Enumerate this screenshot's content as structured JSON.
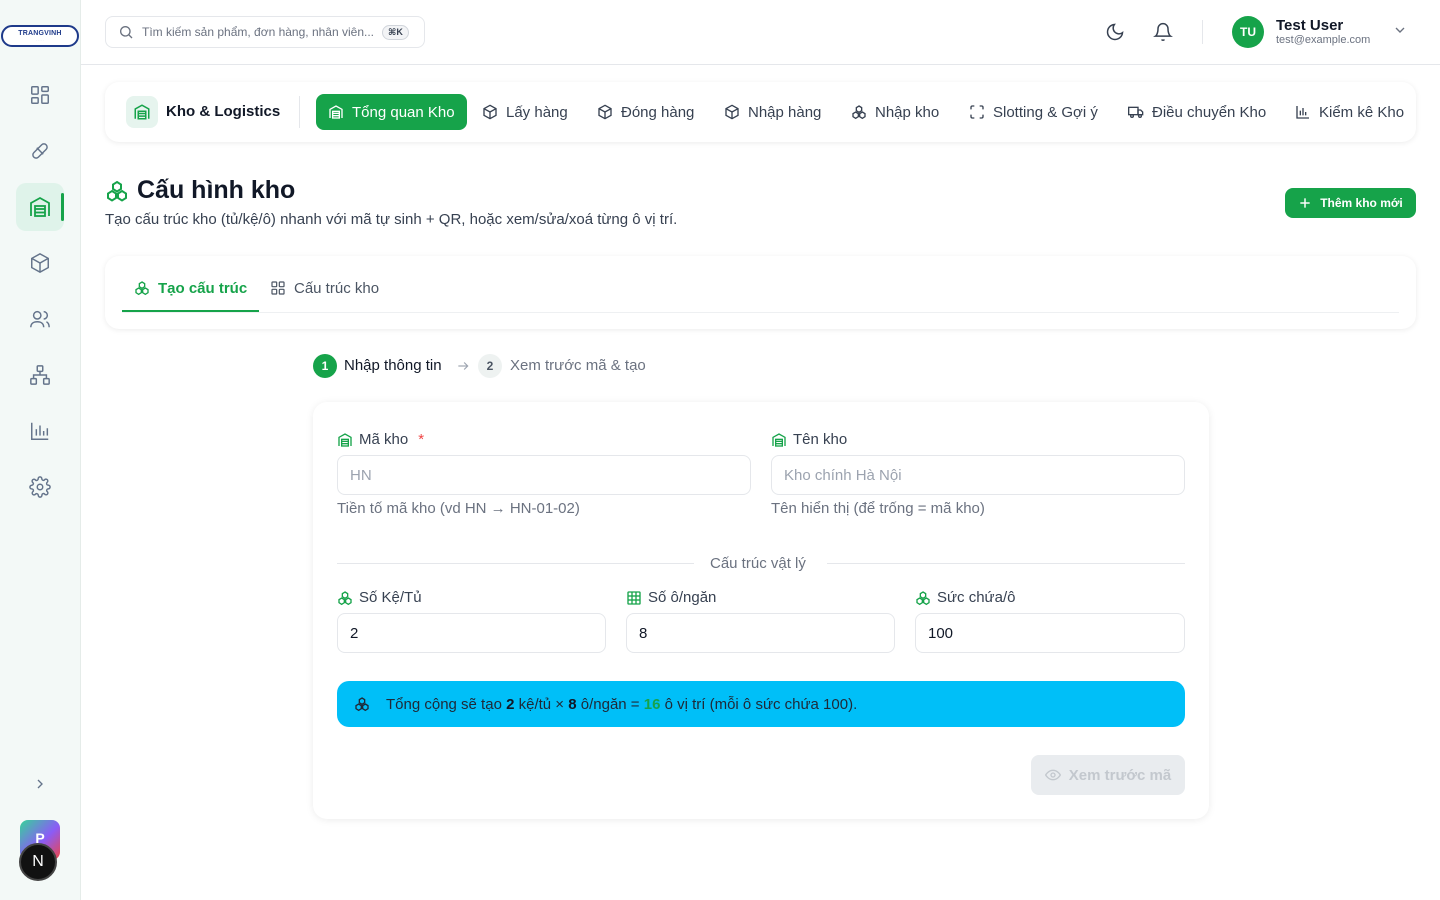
{
  "brand": {
    "logo_line1": "TRANGVINH",
    "logo_line2": "· · · · ·"
  },
  "sidebar": {
    "items": [
      {
        "icon": "dashboard-icon"
      },
      {
        "icon": "pill-icon"
      },
      {
        "icon": "warehouse-icon",
        "active": true
      },
      {
        "icon": "box-icon"
      },
      {
        "icon": "users-icon"
      },
      {
        "icon": "org-chart-icon"
      },
      {
        "icon": "bar-chart-icon"
      },
      {
        "icon": "gear-icon"
      }
    ],
    "tile_p": "P",
    "tile_n": "N"
  },
  "header": {
    "search_placeholder": "Tìm kiếm sản phẩm, đơn hàng, nhân viên...",
    "search_shortcut": "⌘K",
    "user": {
      "initials": "TU",
      "name": "Test User",
      "email": "test@example.com"
    }
  },
  "nav": {
    "brand": "Kho & Logistics",
    "tabs": [
      {
        "label": "Tổng quan Kho",
        "icon": "warehouse-icon",
        "active": true
      },
      {
        "label": "Lấy hàng",
        "icon": "box-icon"
      },
      {
        "label": "Đóng hàng",
        "icon": "box-icon"
      },
      {
        "label": "Nhập hàng",
        "icon": "box-icon"
      },
      {
        "label": "Nhập kho",
        "icon": "boxes-icon"
      },
      {
        "label": "Slotting & Gợi ý",
        "icon": "scan-icon"
      },
      {
        "label": "Điều chuyển Kho",
        "icon": "truck-icon"
      },
      {
        "label": "Kiểm kê Kho",
        "icon": "bar-chart-icon"
      }
    ]
  },
  "page": {
    "title": "Cấu hình kho",
    "subtitle": "Tạo cấu trúc kho (tủ/kệ/ô) nhanh với mã tự sinh + QR, hoặc xem/sửa/xoá từng ô vị trí.",
    "add_button": "Thêm kho mới"
  },
  "tabs": [
    {
      "label": "Tạo cấu trúc",
      "active": true
    },
    {
      "label": "Cấu trúc kho"
    }
  ],
  "stepper": [
    {
      "num": "1",
      "label": "Nhập thông tin",
      "active": true
    },
    {
      "num": "2",
      "label": "Xem trước mã & tạo"
    }
  ],
  "form": {
    "code": {
      "label": "Mã kho",
      "required_mark": "*",
      "placeholder": "HN",
      "help": "Tiền tố mã kho (vd HN → HN-01-02)"
    },
    "name": {
      "label": "Tên kho",
      "placeholder": "Kho chính Hà Nội",
      "help": "Tên hiển thị (để trống = mã kho)"
    },
    "section_title": "Cấu trúc vật lý",
    "shelves": {
      "label": "Số Kệ/Tủ",
      "value": "2"
    },
    "bins": {
      "label": "Số ô/ngăn",
      "value": "8"
    },
    "capacity": {
      "label": "Sức chứa/ô",
      "value": "100"
    },
    "summary": {
      "p1": "Tổng cộng sẽ tạo",
      "shelves": "2",
      "p2": "kệ/tủ ×",
      "bins": "8",
      "p3": "ô/ngăn =",
      "total": "16",
      "p4": "ô vị trí (mỗi ô sức chứa 100)."
    },
    "preview_button": "Xem trước mã"
  },
  "colors": {
    "primary": "#16a34a",
    "info": "#00bff8",
    "danger": "#ef4444"
  }
}
